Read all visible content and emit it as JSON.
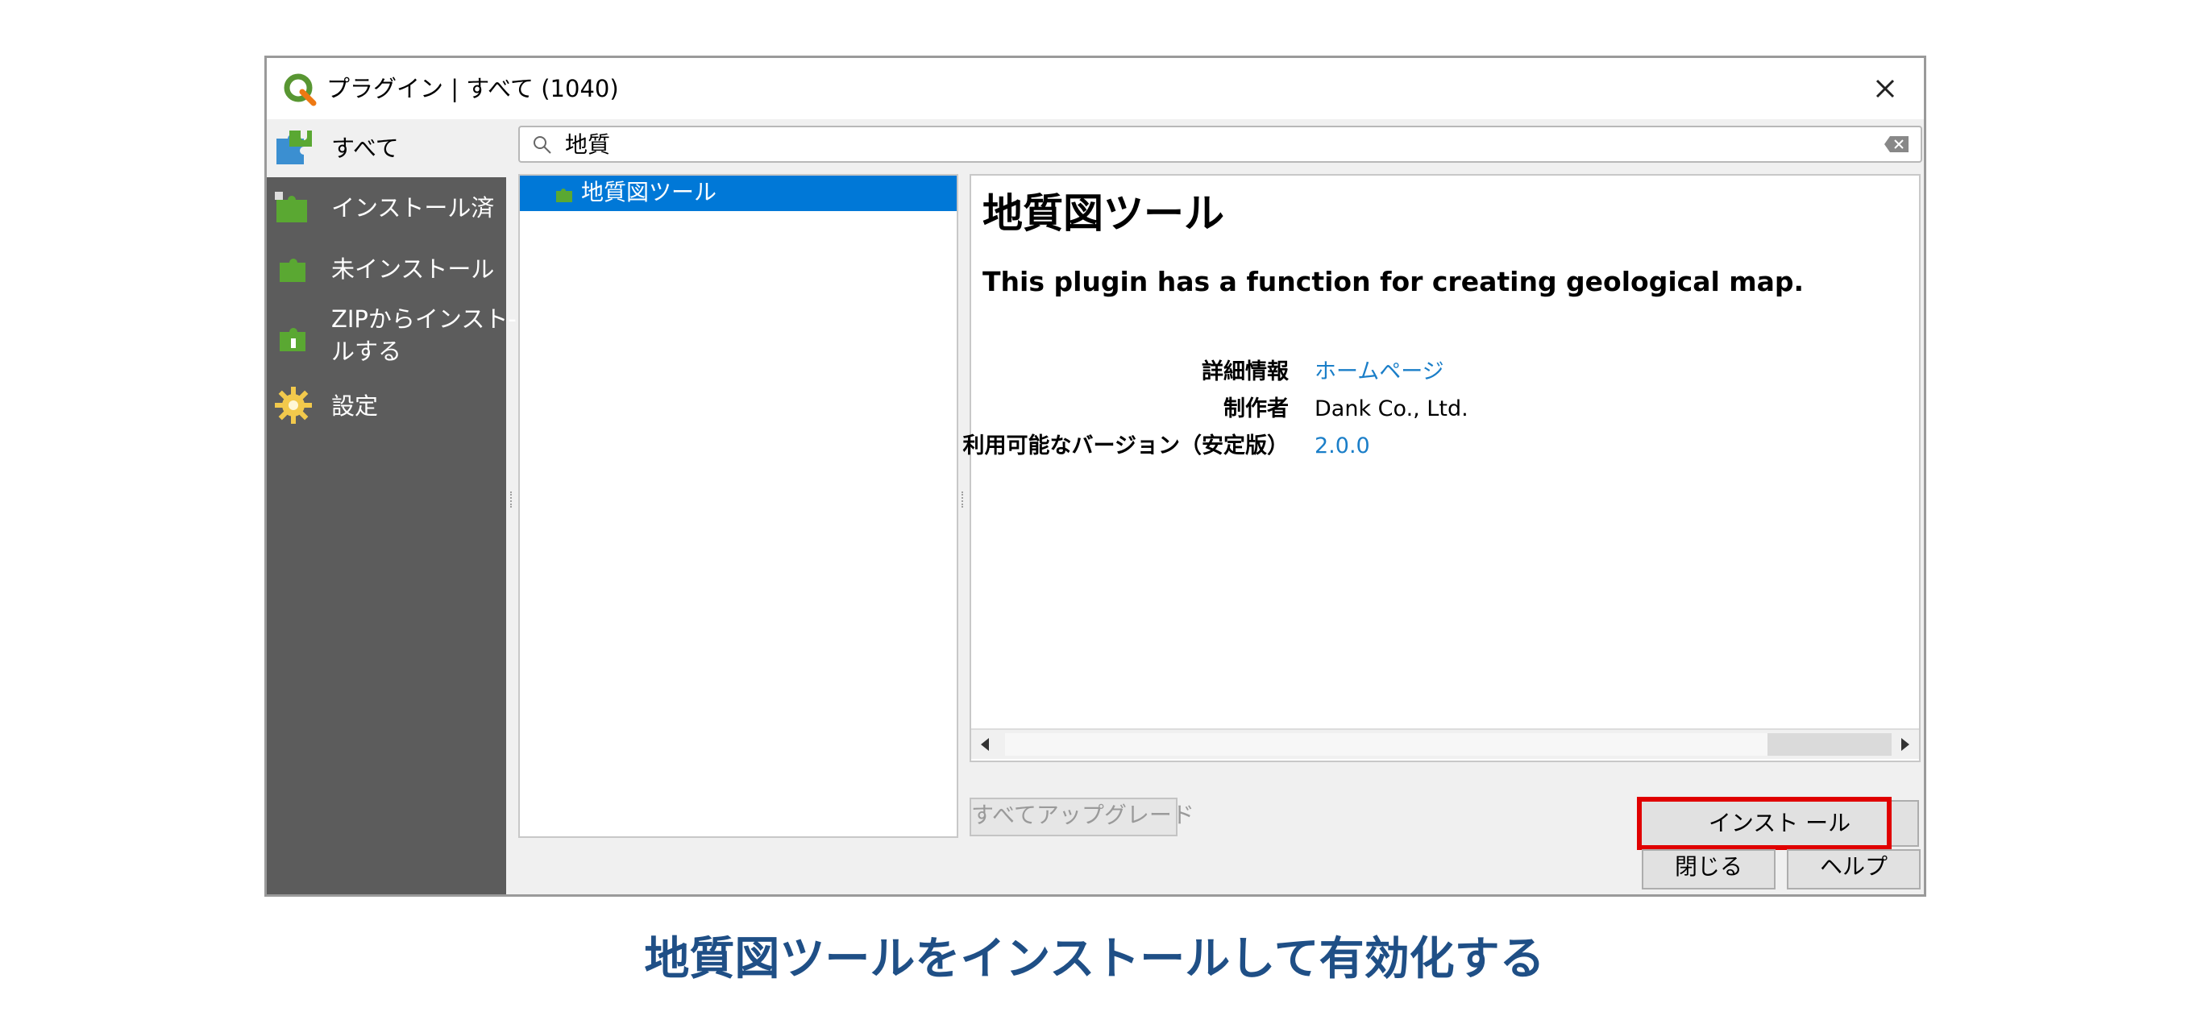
{
  "window": {
    "title": "プラグイン | すべて (1040)",
    "close_label": "×"
  },
  "sidebar": {
    "items": [
      {
        "label": "すべて",
        "icon": "puzzle-all-icon"
      },
      {
        "label": "インストール済",
        "icon": "puzzle-installed-icon"
      },
      {
        "label": "未インストール",
        "icon": "puzzle-not-installed-icon"
      },
      {
        "label_line1": "ZIPからインスト-",
        "label_line2": "ルする",
        "icon": "puzzle-zip-icon"
      },
      {
        "label": "設定",
        "icon": "gear-icon"
      }
    ]
  },
  "search": {
    "value": "地質"
  },
  "plugin_list": {
    "items": [
      {
        "label": "地質図ツール",
        "selected": true
      }
    ]
  },
  "details": {
    "title": "地質図ツール",
    "description": "This plugin has a function for creating geological map.",
    "rows": [
      {
        "key": "詳細情報",
        "value": "ホームページ",
        "link": true
      },
      {
        "key": "制作者",
        "value": "Dank Co., Ltd.",
        "link": false
      },
      {
        "key": "利用可能なバージョン（安定版）",
        "value": "2.0.0",
        "link": true
      }
    ]
  },
  "buttons": {
    "upgrade_all": "すべてアップグレード",
    "install": "インスト ール",
    "close": "閉じる",
    "help": "ヘルプ"
  },
  "caption": "地質図ツールをインストールして有効化する",
  "colors": {
    "selection": "#0078d7",
    "sidebar_bg": "#5c5c5c",
    "link": "#1a7ec8",
    "highlight_box": "#e00000",
    "caption": "#1f4f86"
  }
}
